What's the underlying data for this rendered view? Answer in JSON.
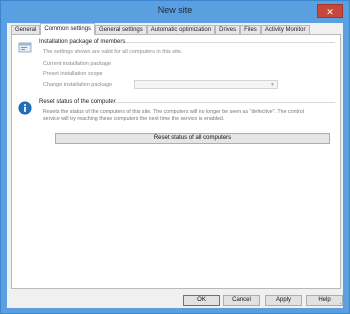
{
  "window": {
    "title": "New site",
    "close_glyph": "✕"
  },
  "tabs": [
    {
      "label": "General",
      "active": false
    },
    {
      "label": "Common settings",
      "active": true
    },
    {
      "label": "General settings",
      "active": false
    },
    {
      "label": "Automatic optimization",
      "active": false
    },
    {
      "label": "Drives",
      "active": false
    },
    {
      "label": "Files",
      "active": false
    },
    {
      "label": "Activity Monitor",
      "active": false
    }
  ],
  "install_group": {
    "title": "Installation package of members",
    "icon": "install-package-icon",
    "note": "The settings shown are valid for all computers in this site.",
    "current_label": "Current installation package",
    "preset_label": "Preset installation scope",
    "change_label": "Change installation package",
    "change_value": ""
  },
  "reset_group": {
    "title": "Reset status of the computer",
    "icon": "info-icon",
    "description_line1": "Resets the status of the computers of this site. The computers will no longer be seen as \"defective\". The control",
    "description_line2": "service will try reaching these computers the next time the service is enabled.",
    "button_label": "Reset status of all computers"
  },
  "buttons": {
    "ok": "OK",
    "cancel": "Cancel",
    "apply": "Apply",
    "help": "Help"
  },
  "colors": {
    "title_bar": "#5aa0e0",
    "close": "#c7473a",
    "info_icon": "#1f6fbf"
  }
}
